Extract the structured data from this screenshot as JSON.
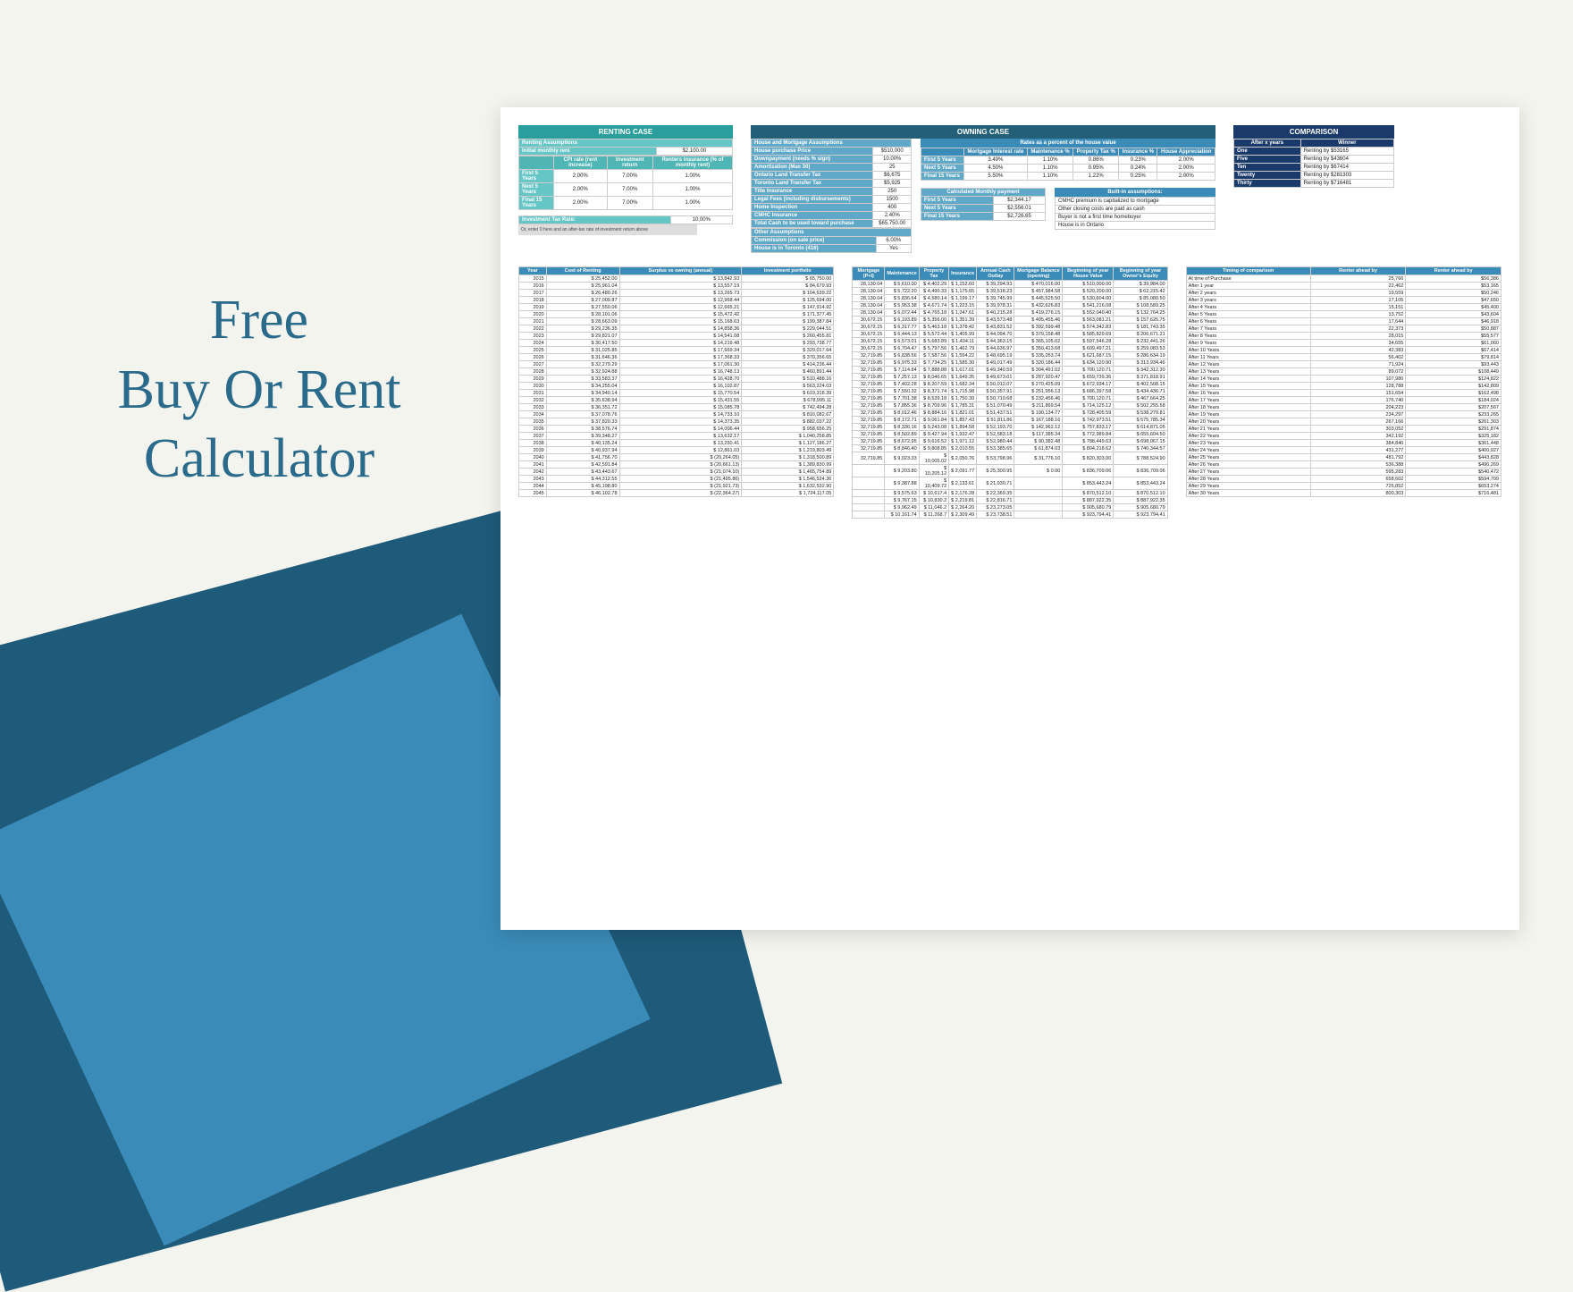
{
  "title": "Free\nBuy Or Rent\nCalculator",
  "renting": {
    "header": "RENTING CASE",
    "assumptions_label": "Renting Assumptions",
    "initial_rent_label": "Initial monthly rent",
    "initial_rent_value": "$2,100.00",
    "cols": [
      "CPI rate (rent increase)",
      "Investment return",
      "Renters insurance (% of monthly rent)"
    ],
    "rows": [
      {
        "label": "First 5 Years",
        "v": [
          "2.00%",
          "7.00%",
          "1.00%"
        ]
      },
      {
        "label": "Next 5 Years",
        "v": [
          "2.00%",
          "7.00%",
          "1.00%"
        ]
      },
      {
        "label": "Final 15 Years",
        "v": [
          "2.00%",
          "7.00%",
          "1.00%"
        ]
      }
    ],
    "tax_label": "Investment Tax Rate:",
    "tax_value": "10.00%",
    "tax_note": "Or, enter 0 here and an after-tax rate of investment return above"
  },
  "owning": {
    "header": "OWNING CASE",
    "house_label": "House and Mortgage Assumptions",
    "house_rows": [
      [
        "House purchase Price",
        "$510,000"
      ],
      [
        "Downpayment (needs % sign)",
        "10.00%"
      ],
      [
        "Amortization (Max 30)",
        "25"
      ],
      [
        "Ontario Land Transfer Tax",
        "$6,675"
      ],
      [
        "Toronto Land Transfer Tax",
        "$5,925"
      ],
      [
        "Title Insurance",
        "250"
      ],
      [
        "Legal Fees (including disbursements)",
        "1500"
      ],
      [
        "Home Inspection",
        "400"
      ],
      [
        "CMHC Insurance",
        "2.40%"
      ],
      [
        "Total Cash to be used toward purchase",
        "$65,750.00"
      ]
    ],
    "other_label": "Other Assumptions",
    "other_rows": [
      [
        "Commission (on sale price)",
        "6.00%"
      ],
      [
        "House is in Toronto (416)",
        "Yes"
      ]
    ],
    "rates_label": "Rates as a percent of the house value",
    "rates_cols": [
      "Mortgage Interest rate",
      "Maintenance %",
      "Property Tax %",
      "Insurance %",
      "House Appreciation"
    ],
    "rates_rows": [
      {
        "label": "First 5 Years",
        "v": [
          "3.49%",
          "1.10%",
          "0.86%",
          "0.23%",
          "2.00%"
        ]
      },
      {
        "label": "Next 5 Years",
        "v": [
          "4.50%",
          "1.10%",
          "0.95%",
          "0.24%",
          "2.00%"
        ]
      },
      {
        "label": "Final 15 Years",
        "v": [
          "5.50%",
          "1.10%",
          "1.22%",
          "0.25%",
          "2.00%"
        ]
      }
    ],
    "monthly_label": "Calculated Monthly payment",
    "monthly_rows": [
      [
        "First 5 Years",
        "$2,344.17"
      ],
      [
        "Next 5 Years",
        "$2,556.01"
      ],
      [
        "Final 15 Years",
        "$2,726.65"
      ]
    ],
    "builtin_label": "Built-in assumptions:",
    "builtin_rows": [
      "CMHC premium is capitalized to mortgage",
      "Other closing costs are paid as cash",
      "Buyer is not a first time homebuyer",
      "House is in Ontario"
    ]
  },
  "comparison": {
    "header": "COMPARISON",
    "cols": [
      "After x years",
      "Winner"
    ],
    "rows": [
      [
        "One",
        "Renting by $53165"
      ],
      [
        "Five",
        "Renting by $43604"
      ],
      [
        "Ten",
        "Renting by $67414"
      ],
      [
        "Twenty",
        "Renting by $281303"
      ],
      [
        "Thirty",
        "Renting by $716481"
      ]
    ]
  },
  "rent_table": {
    "cols": [
      "Year",
      "Cost of Renting",
      "Surplus vs owning (annual)",
      "Investment portfolio"
    ],
    "rows": [
      [
        "2015",
        "$ 25,452.00",
        "$ 13,842.93",
        "$ 65,750.00"
      ],
      [
        "2016",
        "$ 25,961.04",
        "$ 13,557.19",
        "$ 84,679.93"
      ],
      [
        "2017",
        "$ 26,480.26",
        "$ 13,265.73",
        "$ 104,639.22"
      ],
      [
        "2018",
        "$ 27,009.87",
        "$ 12,968.44",
        "$ 125,694.00"
      ],
      [
        "2019",
        "$ 27,550.06",
        "$ 12,665.21",
        "$ 147,914.92"
      ],
      [
        "2020",
        "$ 28,101.06",
        "$ 15,472.42",
        "$ 171,377.45"
      ],
      [
        "2021",
        "$ 28,663.09",
        "$ 15,168.63",
        "$ 199,387.84"
      ],
      [
        "2022",
        "$ 29,236.35",
        "$ 14,858.36",
        "$ 229,044.51"
      ],
      [
        "2023",
        "$ 29,821.07",
        "$ 14,541.08",
        "$ 260,455.81"
      ],
      [
        "2024",
        "$ 30,417.50",
        "$ 14,219.48",
        "$ 293,738.77"
      ],
      [
        "2025",
        "$ 31,025.85",
        "$ 17,669.34",
        "$ 329,017.64"
      ],
      [
        "2026",
        "$ 31,646.36",
        "$ 17,368.33",
        "$ 370,356.65"
      ],
      [
        "2027",
        "$ 32,279.29",
        "$ 17,061.30",
        "$ 414,236.44"
      ],
      [
        "2028",
        "$ 32,924.88",
        "$ 16,748.13",
        "$ 460,891.44"
      ],
      [
        "2029",
        "$ 33,583.37",
        "$ 16,428.70",
        "$ 510,488.16"
      ],
      [
        "2030",
        "$ 34,255.04",
        "$ 16,102.87",
        "$ 563,224.03"
      ],
      [
        "2031",
        "$ 34,940.14",
        "$ 15,770.54",
        "$ 619,318.39"
      ],
      [
        "2032",
        "$ 35,638.94",
        "$ 15,431.55",
        "$ 678,995.11"
      ],
      [
        "2033",
        "$ 36,351.72",
        "$ 15,085.78",
        "$ 742,494.28"
      ],
      [
        "2034",
        "$ 37,078.76",
        "$ 14,733.10",
        "$ 810,082.67"
      ],
      [
        "2035",
        "$ 37,820.33",
        "$ 14,373.35",
        "$ 882,037.22"
      ],
      [
        "2036",
        "$ 38,576.74",
        "$ 14,006.44",
        "$ 958,656.25"
      ],
      [
        "2037",
        "$ 39,348.27",
        "$ 13,632.17",
        "$ 1,040,258.85"
      ],
      [
        "2038",
        "$ 40,135.24",
        "$ 13,250.41",
        "$ 1,127,186.27"
      ],
      [
        "2039",
        "$ 40,937.94",
        "$ 12,861.03",
        "$ 1,219,803.49"
      ],
      [
        "2040",
        "$ 41,756.70",
        "$ (20,264.05)",
        "$ 1,318,500.89"
      ],
      [
        "2041",
        "$ 42,591.84",
        "$ (20,661.13)",
        "$ 1,389,830.99"
      ],
      [
        "2042",
        "$ 43,443.67",
        "$ (21,074.10)",
        "$ 1,465,754.89"
      ],
      [
        "2043",
        "$ 44,312.55",
        "$ (21,495.86)",
        "$ 1,546,524.36"
      ],
      [
        "2044",
        "$ 45,198.80",
        "$ (21,921.73)",
        "$ 1,632,532.90"
      ],
      [
        "2045",
        "$ 46,102.78",
        "$ (22,364.27)",
        "$ 1,724,117.05"
      ]
    ]
  },
  "own_table": {
    "cols": [
      "Mortgage (P+I)",
      "Maintenance",
      "Property Tax",
      "Insurance",
      "Annual Cash Outlay",
      "Mortgage Balance (opening)",
      "Beginning of year House Value",
      "Beginning of year Owner's Equity"
    ],
    "rows": [
      [
        "28,130.04",
        "$ 5,610.00",
        "$ 4,402.29",
        "$ 1,152.60",
        "$ 39,294.93",
        "$ 470,016.00",
        "$ 510,000.00",
        "$ 39,984.00"
      ],
      [
        "28,130.04",
        "$ 5,722.20",
        "$ 4,490.33",
        "$ 1,175.65",
        "$ 39,518.23",
        "$ 457,984.58",
        "$ 520,200.00",
        "$ 62,215.42"
      ],
      [
        "28,130.04",
        "$ 5,836.64",
        "$ 4,580.14",
        "$ 1,199.17",
        "$ 39,745.99",
        "$ 445,525.50",
        "$ 530,604.00",
        "$ 85,080.50"
      ],
      [
        "28,130.04",
        "$ 5,953.38",
        "$ 4,671.74",
        "$ 1,223.15",
        "$ 39,978.31",
        "$ 432,626.83",
        "$ 541,216.08",
        "$ 108,589.25"
      ],
      [
        "28,130.04",
        "$ 6,072.44",
        "$ 4,765.18",
        "$ 1,247.61",
        "$ 40,215.28",
        "$ 419,276.15",
        "$ 552,040.40",
        "$ 132,764.25"
      ],
      [
        "30,672.15",
        "$ 6,193.89",
        "$ 5,356.00",
        "$ 1,351.39",
        "$ 43,573.48",
        "$ 405,455.46",
        "$ 563,081.21",
        "$ 157,625.75"
      ],
      [
        "30,672.15",
        "$ 6,317.77",
        "$ 5,463.18",
        "$ 1,378.42",
        "$ 43,831.52",
        "$ 392,599.48",
        "$ 574,342.83",
        "$ 181,743.35"
      ],
      [
        "30,672.15",
        "$ 6,444.13",
        "$ 5,572.44",
        "$ 1,405.99",
        "$ 44,094.70",
        "$ 379,158.48",
        "$ 585,829.69",
        "$ 206,671.21"
      ],
      [
        "30,672.15",
        "$ 6,573.01",
        "$ 5,683.89",
        "$ 1,434.11",
        "$ 44,363.15",
        "$ 365,105.02",
        "$ 597,546.28",
        "$ 232,441.26"
      ],
      [
        "30,672.15",
        "$ 6,704.47",
        "$ 5,797.56",
        "$ 1,462.79",
        "$ 44,636.97",
        "$ 350,413.68",
        "$ 609,497.21",
        "$ 259,083.53"
      ],
      [
        "32,719.85",
        "$ 6,838.56",
        "$ 7,587.56",
        "$ 1,554.22",
        "$ 48,695.19",
        "$ 335,053.74",
        "$ 621,687.15",
        "$ 286,634.19"
      ],
      [
        "32,719.85",
        "$ 6,975.33",
        "$ 7,734.25",
        "$ 1,585.30",
        "$ 49,017.49",
        "$ 320,186.44",
        "$ 634,120.90",
        "$ 313,934.46"
      ],
      [
        "32,719.85",
        "$ 7,114.84",
        "$ 7,888.88",
        "$ 1,617.01",
        "$ 49,340.59",
        "$ 304,491.02",
        "$ 700,120.71",
        "$ 342,312.30"
      ],
      [
        "32,719.85",
        "$ 7,257.13",
        "$ 8,046.65",
        "$ 1,649.35",
        "$ 49,673.01",
        "$ 287,920.47",
        "$ 659,739.36",
        "$ 371,818.91"
      ],
      [
        "32,719.85",
        "$ 7,402.28",
        "$ 8,207.59",
        "$ 1,682.34",
        "$ 50,012.07",
        "$ 270,425.09",
        "$ 672,934.17",
        "$ 402,508.15"
      ],
      [
        "32,719.85",
        "$ 7,550.32",
        "$ 8,371.74",
        "$ 1,715.98",
        "$ 50,357.91",
        "$ 251,956.13",
        "$ 686,397.58",
        "$ 434,436.71"
      ],
      [
        "32,719.85",
        "$ 7,701.38",
        "$ 8,539.18",
        "$ 1,750.30",
        "$ 50,710.68",
        "$ 232,456.46",
        "$ 700,120.71",
        "$ 467,664.25"
      ],
      [
        "32,719.85",
        "$ 7,855.36",
        "$ 8,709.96",
        "$ 1,785.31",
        "$ 51,070.49",
        "$ 211,869.54",
        "$ 714,125.12",
        "$ 502,255.58"
      ],
      [
        "32,719.85",
        "$ 8,012.46",
        "$ 8,884.16",
        "$ 1,821.01",
        "$ 51,437.51",
        "$ 190,134.77",
        "$ 728,405.59",
        "$ 538,270.81"
      ],
      [
        "32,719.85",
        "$ 8,172.71",
        "$ 9,061.84",
        "$ 1,857.43",
        "$ 51,811.86",
        "$ 167,188.16",
        "$ 742,973.51",
        "$ 575,785.34"
      ],
      [
        "32,719.85",
        "$ 8,336.16",
        "$ 9,243.08",
        "$ 1,894.58",
        "$ 52,193.70",
        "$ 142,962.12",
        "$ 757,833.17",
        "$ 614,871.05"
      ],
      [
        "32,719.85",
        "$ 8,502.89",
        "$ 9,427.94",
        "$ 1,932.47",
        "$ 52,583.18",
        "$ 117,385.34",
        "$ 772,989.84",
        "$ 655,604.50"
      ],
      [
        "32,719.85",
        "$ 8,672.95",
        "$ 9,616.52",
        "$ 1,971.12",
        "$ 52,980.44",
        "$ 90,382.48",
        "$ 788,449.63",
        "$ 698,067.15"
      ],
      [
        "32,719.85",
        "$ 8,846.40",
        "$ 9,808.85",
        "$ 2,010.55",
        "$ 53,385.65",
        "$ 61,874.03",
        "$ 804,218.62",
        "$ 740,344.57"
      ],
      [
        "32,719.85",
        "$ 9,023.33",
        "$ 10,005.02",
        "$ 2,050.76",
        "$ 53,798.96",
        "$ 31,776.10",
        "$ 820,303.00",
        "$ 788,524.90"
      ],
      [
        "",
        "$ 9,203.80",
        "$ 10,205.12",
        "$ 2,091.77",
        "$ 25,300.95",
        "$ 0.00",
        "$ 836,709.06",
        "$ 836,709.06"
      ],
      [
        "",
        "$ 9,387.88",
        "$ 10,409.72",
        "$ 2,133.61",
        "$ 21,930.71",
        "",
        "$ 853,443.24",
        "$ 853,443.24"
      ],
      [
        "",
        "$ 9,575.63",
        "$ 10,617.4",
        "$ 2,176.28",
        "$ 22,369.35",
        "",
        "$ 870,512.10",
        "$ 870,512.10"
      ],
      [
        "",
        "$ 9,767.15",
        "$ 10,830.2",
        "$ 2,219.81",
        "$ 22,816.71",
        "",
        "$ 887,922.35",
        "$ 887,922.35"
      ],
      [
        "",
        "$ 9,962.49",
        "$ 11,046.2",
        "$ 2,264.20",
        "$ 23,273.05",
        "",
        "$ 905,680.79",
        "$ 905,680.79"
      ],
      [
        "",
        "$ 10,161.74",
        "$ 11,268.7",
        "$ 2,309.49",
        "$ 23,738.51",
        "",
        "$ 923,794.41",
        "$ 923,794.41"
      ]
    ]
  },
  "compare_table": {
    "cols": [
      "Timing of comparison",
      "Renter ahead by",
      "Renter ahead by"
    ],
    "rows": [
      [
        "At time of Purchase",
        "25,766",
        "$56,386"
      ],
      [
        "After 1 year",
        "22,462",
        "$53,165"
      ],
      [
        "After 2 years",
        "19,559",
        "$50,246"
      ],
      [
        "After 3 years",
        "17,105",
        "$47,650"
      ],
      [
        "After 4 Years",
        "15,151",
        "$45,400"
      ],
      [
        "After 5 Years",
        "13,752",
        "$43,604"
      ],
      [
        "After 6 Years",
        "17,644",
        "$46,918"
      ],
      [
        "After 7 Years",
        "22,373",
        "$50,887"
      ],
      [
        "After 8 Years",
        "28,015",
        "$55,577"
      ],
      [
        "After 9 Years",
        "34,655",
        "$61,060"
      ],
      [
        "After 10 Years",
        "42,383",
        "$67,414"
      ],
      [
        "After 11 Years",
        "56,402",
        "$79,814"
      ],
      [
        "After 12 Years",
        "71,924",
        "$93,443"
      ],
      [
        "After 13 Years",
        "89,072",
        "$108,449"
      ],
      [
        "After 14 Years",
        "107,980",
        "$124,822"
      ],
      [
        "After 15 Years",
        "128,788",
        "$142,809"
      ],
      [
        "After 16 Years",
        "151,654",
        "$162,498"
      ],
      [
        "After 17 Years",
        "176,740",
        "$184,024"
      ],
      [
        "After 18 Years",
        "204,223",
        "$207,567"
      ],
      [
        "After 19 Years",
        "234,297",
        "$233,265"
      ],
      [
        "After 20 Years",
        "267,166",
        "$261,303"
      ],
      [
        "After 21 Years",
        "303,052",
        "$291,874"
      ],
      [
        "After 22 Years",
        "342,192",
        "$325,182"
      ],
      [
        "After 23 Years",
        "384,840",
        "$361,448"
      ],
      [
        "After 24 Years",
        "431,277",
        "$400,927"
      ],
      [
        "After 25 Years",
        "481,792",
        "$443,828"
      ],
      [
        "After 26 Years",
        "536,388",
        "$490,269"
      ],
      [
        "After 27 Years",
        "595,283",
        "$540,472"
      ],
      [
        "After 28 Years",
        "658,602",
        "$594,709"
      ],
      [
        "After 29 Years",
        "726,852",
        "$653,274"
      ],
      [
        "After 30 Years",
        "800,303",
        "$716,481"
      ]
    ]
  }
}
